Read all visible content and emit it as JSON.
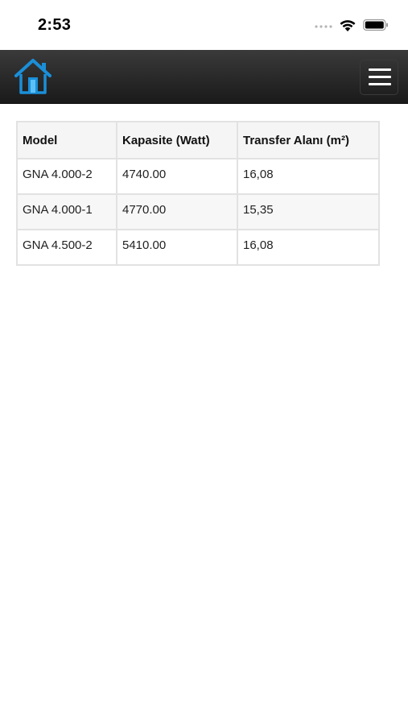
{
  "status_bar": {
    "time": "2:53"
  },
  "nav": {
    "home_icon": "home-icon",
    "menu_icon": "hamburger-menu-icon",
    "accent_color": "#1a8fd8"
  },
  "table": {
    "headers": [
      "Model",
      "Kapasite (Watt)",
      "Transfer Alanı (m²)"
    ],
    "rows": [
      [
        "GNA 4.000-2",
        "4740.00",
        "16,08"
      ],
      [
        "GNA 4.000-1",
        "4770.00",
        "15,35"
      ],
      [
        "GNA 4.500-2",
        "5410.00",
        "16,08"
      ]
    ]
  }
}
